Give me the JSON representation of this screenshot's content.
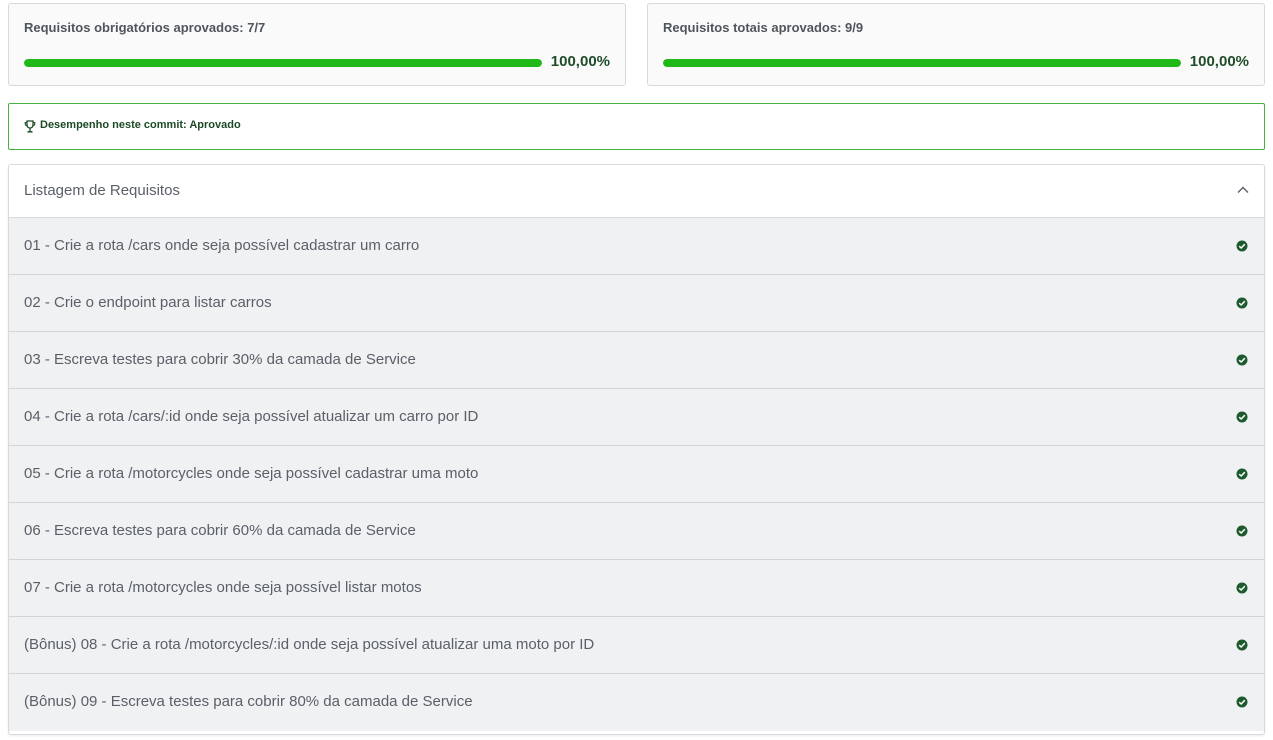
{
  "mandatory": {
    "title": "Requisitos obrigatórios aprovados: 7/7",
    "percent_label": "100,00%",
    "progress": 1.0
  },
  "total": {
    "title": "Requisitos totais aprovados: 9/9",
    "percent_label": "100,00%",
    "progress": 1.0
  },
  "performance": {
    "text": "Desempenho neste commit: Aprovado",
    "icon": "trophy-icon"
  },
  "requirements": {
    "header": "Listagem de Requisitos",
    "toggle_icon": "chevron-up-icon",
    "status_icon": "check-circle-icon",
    "items": [
      "01 - Crie a rota /cars onde seja possível cadastrar um carro",
      "02 - Crie o endpoint para listar carros",
      "03 - Escreva testes para cobrir 30% da camada de Service",
      "04 - Crie a rota /cars/:id onde seja possível atualizar um carro por ID",
      "05 - Crie a rota /motorcycles onde seja possível cadastrar uma moto",
      "06 - Escreva testes para cobrir 60% da camada de Service",
      "07 - Crie a rota /motorcycles onde seja possível listar motos",
      "(Bônus) 08 - Crie a rota /motorcycles/:id onde seja possível atualizar uma moto por ID",
      "(Bônus) 09 - Escreva testes para cobrir 80% da camada de Service"
    ]
  },
  "colors": {
    "progress": "#1fba1a",
    "approved_border": "#46b245",
    "check": "#1d5a2e"
  }
}
